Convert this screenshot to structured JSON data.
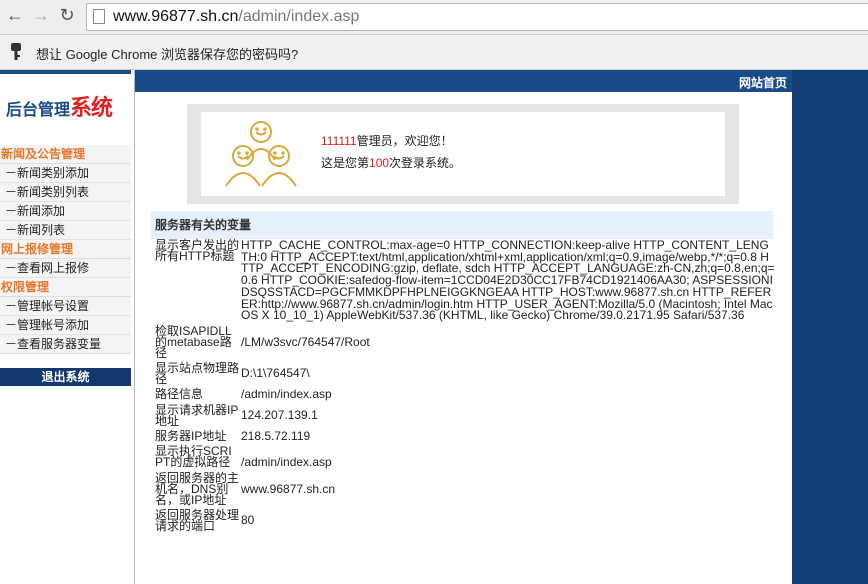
{
  "browser": {
    "back_icon": "←",
    "forward_icon": "→",
    "reload_icon": "↻",
    "url_host": "www.96877.sh.cn",
    "url_path": "/admin/index.asp"
  },
  "infobar": {
    "text": "想让 Google Chrome 浏览器保存您的密码吗?"
  },
  "sidebar": {
    "logo_a": "后台管理",
    "logo_b": "系统",
    "groups": [
      {
        "title": "新闻及公告管理",
        "items": [
          "－新闻类别添加",
          "－新闻类别列表",
          "－新闻添加",
          "－新闻列表"
        ]
      },
      {
        "title": "网上报修管理",
        "items": [
          "－查看网上报修"
        ]
      },
      {
        "title": "权限管理",
        "items": [
          "－管理帐号设置",
          "－管理帐号添加",
          "－查看服务器变量"
        ]
      }
    ],
    "logout": "退出系统"
  },
  "header": {
    "home_link": "网站首页"
  },
  "welcome": {
    "username": "111111",
    "greeting": "管理员，欢迎您！",
    "login_prefix": "这是您第",
    "login_count": "100",
    "login_suffix": "次登录系统。"
  },
  "server_vars": {
    "title": "服务器有关的变量",
    "rows": [
      {
        "label": "显示客户发出的所有HTTP标题",
        "value": "HTTP_CACHE_CONTROL:max-age=0 HTTP_CONNECTION:keep-alive HTTP_CONTENT_LENGTH:0 HTTP_ACCEPT:text/html,application/xhtml+xml,application/xml;q=0.9,image/webp,*/*;q=0.8 HTTP_ACCEPT_ENCODING:gzip, deflate, sdch HTTP_ACCEPT_LANGUAGE:zh-CN,zh;q=0.8,en;q=0.6 HTTP_COOKIE:safedog-flow-item=1CCD04E2D30CC17FB74CD1921406AA30; ASPSESSIONIDSQSSTACD=PGCFMMKDPFHPLNEIGGKNGEAA HTTP_HOST:www.96877.sh.cn HTTP_REFERER:http://www.96877.sh.cn/admin/login.htm HTTP_USER_AGENT:Mozilla/5.0 (Macintosh; Intel Mac OS X 10_10_1) AppleWebKit/537.36 (KHTML, like Gecko) Chrome/39.0.2171.95 Safari/537.36"
      },
      {
        "label": "检取ISAPIDLL的metabase路径",
        "value": "/LM/w3svc/764547/Root"
      },
      {
        "label": "显示站点物理路径",
        "value": "D:\\1\\764547\\"
      },
      {
        "label": "路径信息",
        "value": "/admin/index.asp"
      },
      {
        "label": "显示请求机器IP地址",
        "value": "124.207.139.1"
      },
      {
        "label": "服务器IP地址",
        "value": "218.5.72.119"
      },
      {
        "label": "显示执行SCRIPT的虚拟路径",
        "value": "/admin/index.asp"
      },
      {
        "label": "返回服务器的主机名，DNS别名，或IP地址",
        "value": "www.96877.sh.cn"
      },
      {
        "label": "返回服务器处理请求的端口",
        "value": "80"
      }
    ]
  },
  "colors": {
    "nav_blue": "#1a4a8a",
    "menu_orange": "#e8782a",
    "accent_red": "#d81f1f"
  }
}
